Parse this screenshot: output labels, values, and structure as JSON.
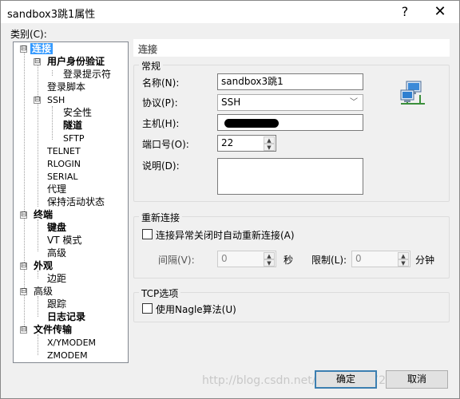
{
  "window": {
    "title": "sandbox3跳1属性",
    "help_glyph": "?",
    "close_glyph": "✕"
  },
  "category_label": "类别(C):",
  "tree": {
    "items": [
      {
        "label": "连接",
        "level": 0,
        "expander": "⊟"
      },
      {
        "label": "用户身份验证",
        "level": 1,
        "expander": "⊟"
      },
      {
        "label": "登录提示符",
        "level": 2
      },
      {
        "label": "登录脚本",
        "level": 1
      },
      {
        "label": "SSH",
        "level": 1,
        "expander": "⊟"
      },
      {
        "label": "安全性",
        "level": 2
      },
      {
        "label": "隧道",
        "level": 2
      },
      {
        "label": "SFTP",
        "level": 2
      },
      {
        "label": "TELNET",
        "level": 1
      },
      {
        "label": "RLOGIN",
        "level": 1
      },
      {
        "label": "SERIAL",
        "level": 1
      },
      {
        "label": "代理",
        "level": 1
      },
      {
        "label": "保持活动状态",
        "level": 1
      },
      {
        "label": "终端",
        "level": 0,
        "expander": "⊟"
      },
      {
        "label": "键盘",
        "level": 1
      },
      {
        "label": "VT 模式",
        "level": 1
      },
      {
        "label": "高级",
        "level": 1
      },
      {
        "label": "外观",
        "level": 0,
        "expander": "⊟"
      },
      {
        "label": "边距",
        "level": 1
      },
      {
        "label": "高级",
        "level": 0,
        "expander": "⊟"
      },
      {
        "label": "跟踪",
        "level": 1
      },
      {
        "label": "日志记录",
        "level": 1
      },
      {
        "label": "文件传输",
        "level": 0,
        "expander": "⊟"
      },
      {
        "label": "X/YMODEM",
        "level": 1
      },
      {
        "label": "ZMODEM",
        "level": 1
      }
    ]
  },
  "panel": {
    "header": "连接",
    "general": {
      "title": "常规",
      "name_label": "名称(N):",
      "name_value": "sandbox3跳1",
      "protocol_label": "协议(P):",
      "protocol_value": "SSH",
      "host_label": "主机(H):",
      "port_label": "端口号(O):",
      "port_value": "22",
      "desc_label": "说明(D):",
      "desc_value": ""
    },
    "reconnect": {
      "title": "重新连接",
      "checkbox_label": "连接异常关闭时自动重新连接(A)",
      "checked": false,
      "interval_label": "间隔(V):",
      "interval_value": "0",
      "seconds_unit": "秒",
      "limit_label": "限制(L):",
      "limit_value": "0",
      "minutes_unit": "分钟"
    },
    "tcp": {
      "title": "TCP选项",
      "nagle_label": "使用Nagle算法(U)",
      "checked": false
    }
  },
  "buttons": {
    "ok": "确定",
    "cancel": "取消"
  },
  "watermark": "http://blog.csdn.net/z295641472"
}
